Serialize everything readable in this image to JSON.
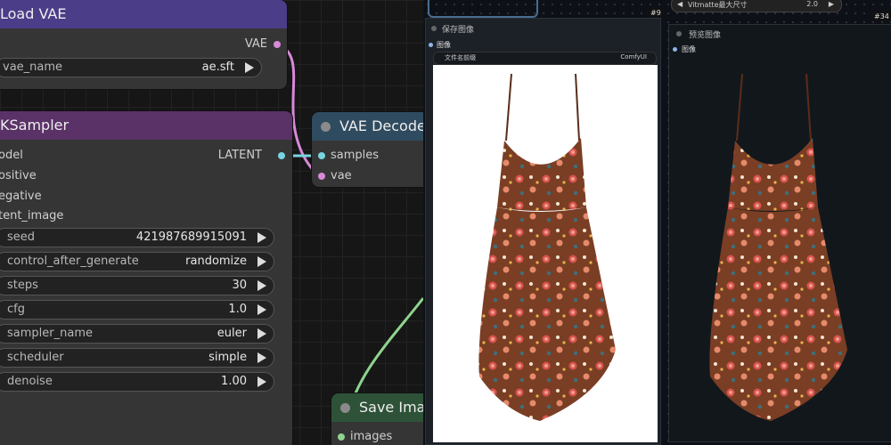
{
  "colors": {
    "load_vae_title": "#4c3d88",
    "ksampler_title": "#5b3268",
    "vae_decode_title": "#2f4b5f",
    "save_image_title": "#2e5238",
    "vae_link": "#d889d8",
    "latent_link": "#79d4df",
    "image_link": "#8ed48e",
    "dress": "#7a3e24"
  },
  "load_vae": {
    "title": "Load VAE",
    "output_label": "VAE",
    "widget": {
      "label": "vae_name",
      "value": "ae.sft"
    }
  },
  "ksampler": {
    "title": "KSampler",
    "inputs": [
      "odel",
      "ositive",
      "egative",
      "tent_image"
    ],
    "output_label": "LATENT",
    "widgets": [
      {
        "label": "seed",
        "value": "421987689915091"
      },
      {
        "label": "control_after_generate",
        "value": "randomize"
      },
      {
        "label": "steps",
        "value": "30"
      },
      {
        "label": "cfg",
        "value": "1.0"
      },
      {
        "label": "sampler_name",
        "value": "euler"
      },
      {
        "label": "scheduler",
        "value": "simple"
      },
      {
        "label": "denoise",
        "value": "1.00"
      }
    ]
  },
  "vae_decode": {
    "title": "VAE Decode",
    "inputs": [
      "samples",
      "vae"
    ]
  },
  "save_image": {
    "title": "Save Imag",
    "input_label": "images"
  },
  "save_panel": {
    "title": "保存图像",
    "input_label": "图像",
    "filename_label": "文件名前缀",
    "filename_value": "ComfyUI",
    "badge": "#9"
  },
  "vitmatte": {
    "label": "Vitmatte最大尺寸",
    "value": "2.0",
    "badge": "#34"
  },
  "preview_panel": {
    "title": "预览图像",
    "input_label": "图像"
  }
}
